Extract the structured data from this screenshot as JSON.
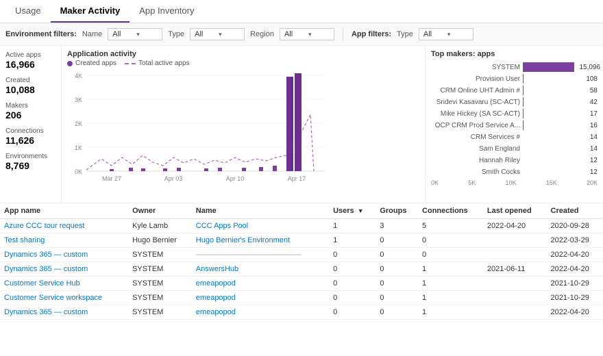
{
  "tabs": [
    {
      "id": "usage",
      "label": "Usage",
      "active": false
    },
    {
      "id": "maker-activity",
      "label": "Maker Activity",
      "active": true
    },
    {
      "id": "app-inventory",
      "label": "App Inventory",
      "active": false
    }
  ],
  "filters": {
    "env_label": "Environment filters:",
    "app_label": "App filters:",
    "fields": [
      {
        "label": "Name",
        "value": "All"
      },
      {
        "label": "Type",
        "value": "All"
      },
      {
        "label": "Region",
        "value": "All"
      }
    ],
    "app_fields": [
      {
        "label": "Type",
        "value": "All"
      }
    ]
  },
  "stats": [
    {
      "title": "Active apps",
      "value": "16,966"
    },
    {
      "title": "Created",
      "value": "10,088"
    },
    {
      "title": "Makers",
      "value": "206"
    },
    {
      "title": "Connections",
      "value": "11,626"
    },
    {
      "title": "Environments",
      "value": "8,769"
    }
  ],
  "chart": {
    "title": "Application activity",
    "legend": [
      {
        "label": "Created apps",
        "type": "solid"
      },
      {
        "label": "Total active apps",
        "type": "dashed"
      }
    ],
    "x_labels": [
      "Mar 27",
      "Apr 03",
      "Apr 10",
      "Apr 17"
    ],
    "y_labels": [
      "4K",
      "3K",
      "2K",
      "1K",
      "0K"
    ]
  },
  "top_makers": {
    "title": "Top makers: apps",
    "items": [
      {
        "name": "SYSTEM",
        "value": 15096,
        "display": "15,096"
      },
      {
        "name": "Provision User",
        "value": 108,
        "display": "108"
      },
      {
        "name": "CRM Online UHT Admin #",
        "value": 58,
        "display": "58"
      },
      {
        "name": "Sridevi Kasavaru (SC-ACT)",
        "value": 42,
        "display": "42"
      },
      {
        "name": "Mike Hickey (SA SC-ACT)",
        "value": 17,
        "display": "17"
      },
      {
        "name": "OCP CRM Prod Service A...",
        "value": 16,
        "display": "16"
      },
      {
        "name": "CRM Services #",
        "value": 14,
        "display": "14"
      },
      {
        "name": "Sam England",
        "value": 14,
        "display": "14"
      },
      {
        "name": "Hannah Riley",
        "value": 12,
        "display": "12"
      },
      {
        "name": "Smith Cocks",
        "value": 12,
        "display": "12"
      }
    ],
    "axis": [
      "0K",
      "5K",
      "10K",
      "15K",
      "20K"
    ],
    "max_value": 20000
  },
  "table": {
    "columns": [
      {
        "id": "app_name",
        "label": "App name"
      },
      {
        "id": "owner",
        "label": "Owner"
      },
      {
        "id": "name",
        "label": "Name"
      },
      {
        "id": "users",
        "label": "Users"
      },
      {
        "id": "groups",
        "label": "Groups"
      },
      {
        "id": "connections",
        "label": "Connections"
      },
      {
        "id": "last_opened",
        "label": "Last opened"
      },
      {
        "id": "created",
        "label": "Created"
      }
    ],
    "rows": [
      {
        "app_name": "Azure CCC tour request",
        "app_link": true,
        "owner": "Kyle Lamb",
        "name": "CCC Apps Pool",
        "name_link": true,
        "users": "1",
        "groups": "3",
        "connections": "5",
        "last_opened": "2022-04-20",
        "created": "2020-09-28"
      },
      {
        "app_name": "Test sharing",
        "app_link": true,
        "owner": "Hugo Bernier",
        "name": "Hugo Bernier's Environment",
        "name_link": true,
        "users": "1",
        "groups": "0",
        "connections": "0",
        "last_opened": "",
        "created": "2022-03-29"
      },
      {
        "app_name": "Dynamics 365 — custom",
        "app_link": true,
        "owner": "SYSTEM",
        "name": "——————————————",
        "name_link": false,
        "users": "0",
        "groups": "0",
        "connections": "0",
        "last_opened": "",
        "created": "2022-04-20"
      },
      {
        "app_name": "Dynamics 365 — custom",
        "app_link": true,
        "owner": "SYSTEM",
        "name": "AnswersHub",
        "name_link": true,
        "users": "0",
        "groups": "0",
        "connections": "1",
        "last_opened": "2021-06-11",
        "created": "2022-04-20"
      },
      {
        "app_name": "Customer Service Hub",
        "app_link": true,
        "owner": "SYSTEM",
        "name": "emeapopod",
        "name_link": true,
        "users": "0",
        "groups": "0",
        "connections": "1",
        "last_opened": "",
        "created": "2021-10-29"
      },
      {
        "app_name": "Customer Service workspace",
        "app_link": true,
        "owner": "SYSTEM",
        "name": "emeapopod",
        "name_link": true,
        "users": "0",
        "groups": "0",
        "connections": "1",
        "last_opened": "",
        "created": "2021-10-29"
      },
      {
        "app_name": "Dynamics 365 — custom",
        "app_link": true,
        "owner": "SYSTEM",
        "name": "emeapopod",
        "name_link": true,
        "users": "0",
        "groups": "0",
        "connections": "1",
        "last_opened": "",
        "created": "2022-04-20"
      }
    ]
  }
}
